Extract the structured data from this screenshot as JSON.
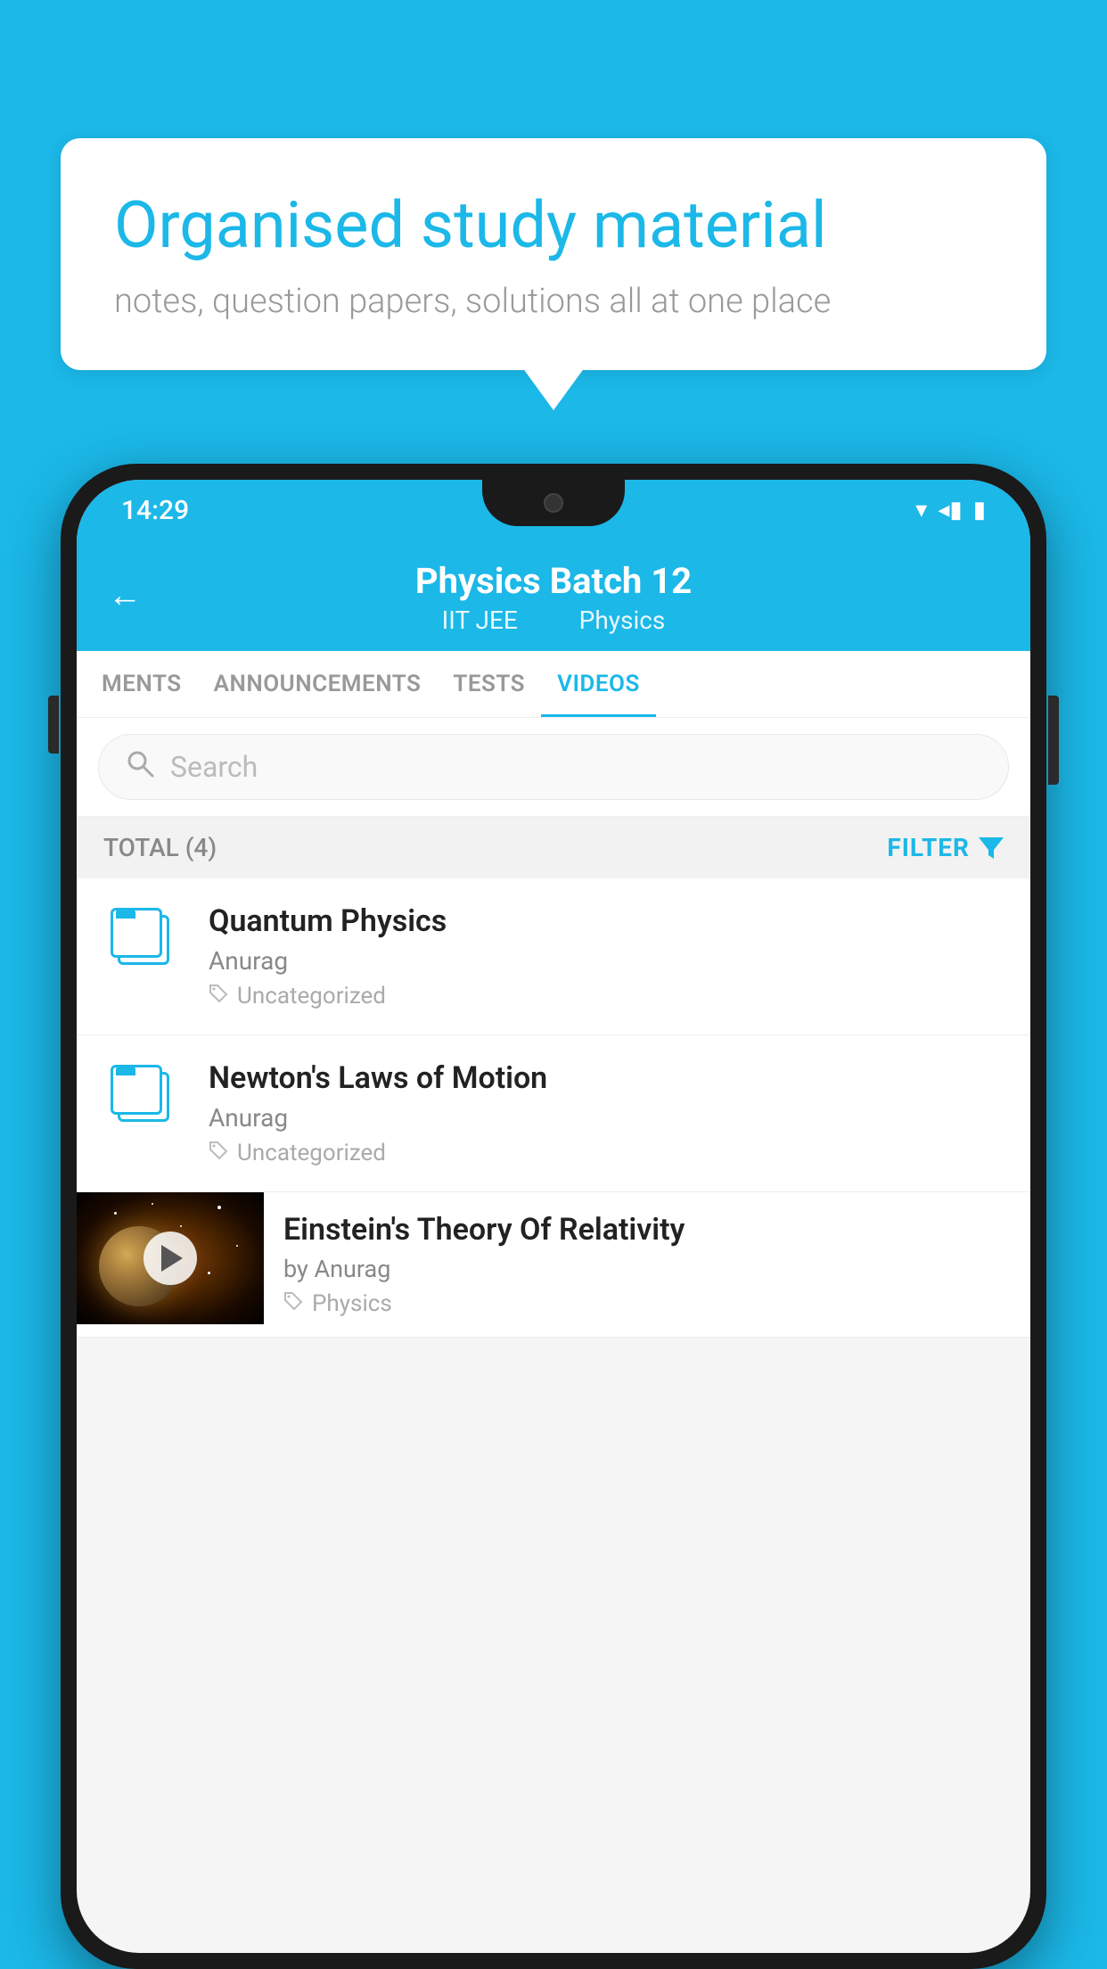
{
  "background_color": "#1BB8E8",
  "bubble": {
    "title": "Organised study material",
    "subtitle": "notes, question papers, solutions all at one place"
  },
  "status_bar": {
    "time": "14:29",
    "wifi": "▾",
    "signal": "▲",
    "battery": "▮"
  },
  "app_header": {
    "back_label": "←",
    "title": "Physics Batch 12",
    "subtitle_part1": "IIT JEE",
    "subtitle_part2": "Physics"
  },
  "tabs": [
    {
      "label": "MENTS",
      "active": false
    },
    {
      "label": "ANNOUNCEMENTS",
      "active": false
    },
    {
      "label": "TESTS",
      "active": false
    },
    {
      "label": "VIDEOS",
      "active": true
    }
  ],
  "search": {
    "placeholder": "Search"
  },
  "filter_bar": {
    "total_label": "TOTAL (4)",
    "filter_label": "FILTER"
  },
  "videos": [
    {
      "title": "Quantum Physics",
      "author": "Anurag",
      "tag": "Uncategorized",
      "has_thumbnail": false
    },
    {
      "title": "Newton's Laws of Motion",
      "author": "Anurag",
      "tag": "Uncategorized",
      "has_thumbnail": false
    },
    {
      "title": "Einstein's Theory Of Relativity",
      "author": "by Anurag",
      "tag": "Physics",
      "has_thumbnail": true
    }
  ]
}
